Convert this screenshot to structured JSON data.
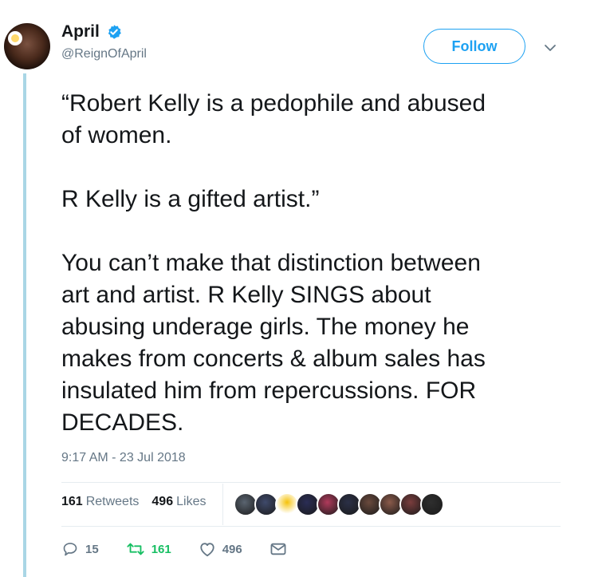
{
  "author": {
    "name": "April",
    "handle": "@ReignOfApril"
  },
  "follow_label": "Follow",
  "tweet": {
    "text": "“Robert Kelly is a pedophile and abused\nof women.\n\nR Kelly is a gifted artist.”\n\nYou can’t make that distinction between\nart and artist. R Kelly SINGS about\nabusing underage girls. The money he\nmakes from concerts & album sales has\ninsulated him from repercussions. FOR\nDECADES.",
    "timestamp": "9:17 AM - 23 Jul 2018"
  },
  "stats": {
    "retweets_count": "161",
    "retweets_label": "Retweets",
    "likes_count": "496",
    "likes_label": "Likes"
  },
  "actions": {
    "replies": "15",
    "retweets": "161",
    "likes": "496"
  },
  "colors": {
    "accent": "#1da1f2",
    "retweet": "#17bf63",
    "thread_line": "#a9d6e5"
  },
  "liker_colors": [
    "#5a6470",
    "#3f4a6b",
    "#f5c20a",
    "#2a2d55",
    "#b03a5b",
    "#2b3047",
    "#6a4a3d",
    "#8a5a4a",
    "#7a3d3d",
    "#2e2e2e"
  ]
}
